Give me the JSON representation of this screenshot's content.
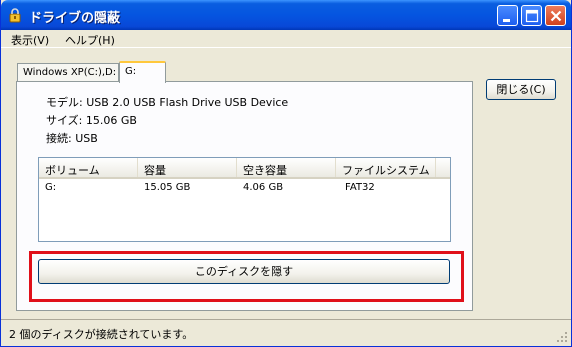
{
  "window": {
    "title": "ドライブの隠蔽",
    "accent": "#0555e0"
  },
  "menu": {
    "view": "表示(V)",
    "help": "ヘルプ(H)"
  },
  "tabs": [
    {
      "label": "Windows XP(C:),D:"
    },
    {
      "label": "G:"
    }
  ],
  "drive_info": {
    "model": "モデル: USB 2.0 USB Flash Drive USB Device",
    "size": "サイズ: 15.06 GB",
    "connection": "接続: USB"
  },
  "volume_list": {
    "columns": [
      "ボリューム",
      "容量",
      "空き容量",
      "ファイルシステム"
    ],
    "rows": [
      [
        "G:",
        "15.05 GB",
        "4.06 GB",
        "FAT32"
      ]
    ]
  },
  "buttons": {
    "close": "閉じる(C)",
    "hide_disk": "このディスクを隠す"
  },
  "status": {
    "text": "2 個のディスクが接続されています。"
  },
  "colors": {
    "highlight": "#e0101a"
  }
}
